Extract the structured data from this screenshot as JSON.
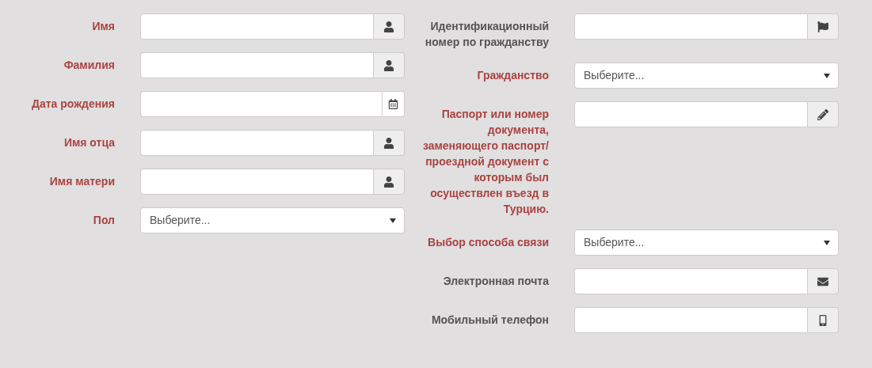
{
  "columns": [
    {
      "fields": [
        {
          "label": "Имя",
          "required": true,
          "kind": "name"
        },
        {
          "label": "Фамилия",
          "required": true,
          "kind": "name"
        },
        {
          "label": "Дата рождения",
          "required": true,
          "kind": "date"
        },
        {
          "label": "Имя отца",
          "required": true,
          "kind": "name"
        },
        {
          "label": "Имя матери",
          "required": true,
          "kind": "name"
        },
        {
          "label": "Пол",
          "required": true,
          "kind": "select",
          "placeholder": "Выберите..."
        }
      ]
    },
    {
      "fields": [
        {
          "label": "Идентификационный номер по гражданству",
          "required": false,
          "kind": "id"
        },
        {
          "label": "Гражданство",
          "required": true,
          "kind": "select",
          "placeholder": "Выберите..."
        },
        {
          "label": "Паспорт или номер документа, заменяющего паспорт/ проездной документ с которым был осуществлен въезд в Турцию.",
          "required": true,
          "kind": "document"
        },
        {
          "label": "Выбор способа связи",
          "required": true,
          "kind": "select",
          "placeholder": "Выберите..."
        },
        {
          "label": "Электронная почта",
          "required": false,
          "kind": "email"
        },
        {
          "label": "Мобильный телефон",
          "required": false,
          "kind": "phone"
        }
      ]
    }
  ]
}
